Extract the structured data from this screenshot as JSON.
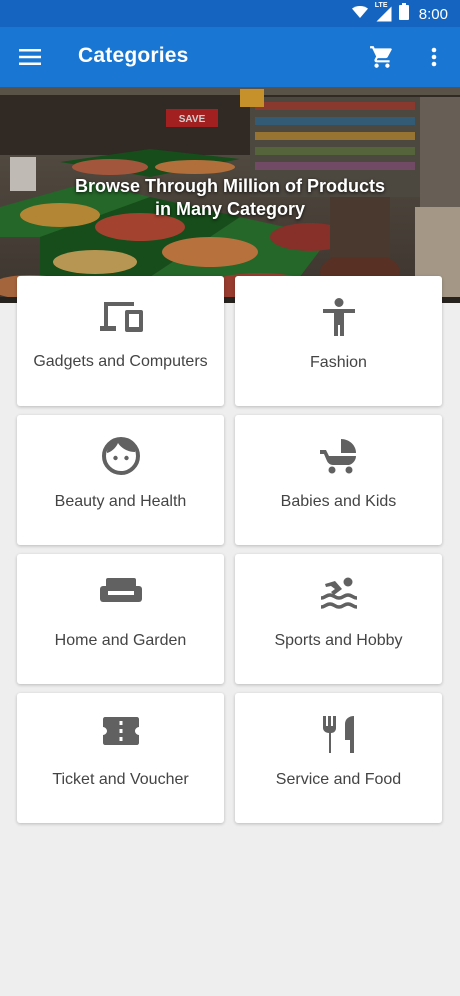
{
  "status_bar": {
    "time": "8:00",
    "network_label": "LTE",
    "icons": [
      "wifi-icon",
      "signal-icon",
      "battery-icon"
    ]
  },
  "app_bar": {
    "title": "Categories",
    "icons": [
      "menu-icon",
      "cart-icon",
      "more-vert-icon"
    ]
  },
  "hero": {
    "line1": "Browse Through Million of Products",
    "line2": "in Many Category",
    "sign_text": "SAVE"
  },
  "categories": [
    {
      "label": "Gadgets and Computers",
      "icon": "devices-icon"
    },
    {
      "label": "Fashion",
      "icon": "person-icon"
    },
    {
      "label": "Beauty and Health",
      "icon": "face-icon"
    },
    {
      "label": "Babies and Kids",
      "icon": "stroller-icon"
    },
    {
      "label": "Home and Garden",
      "icon": "sofa-icon"
    },
    {
      "label": "Sports and Hobby",
      "icon": "swimmer-icon"
    },
    {
      "label": "Ticket and Voucher",
      "icon": "ticket-icon"
    },
    {
      "label": "Service and Food",
      "icon": "restaurant-icon"
    }
  ],
  "colors": {
    "status_bar": "#1565c0",
    "app_bar": "#1976d2",
    "background": "#eeeeee",
    "card": "#ffffff",
    "icon": "#616161",
    "label": "#444444"
  }
}
